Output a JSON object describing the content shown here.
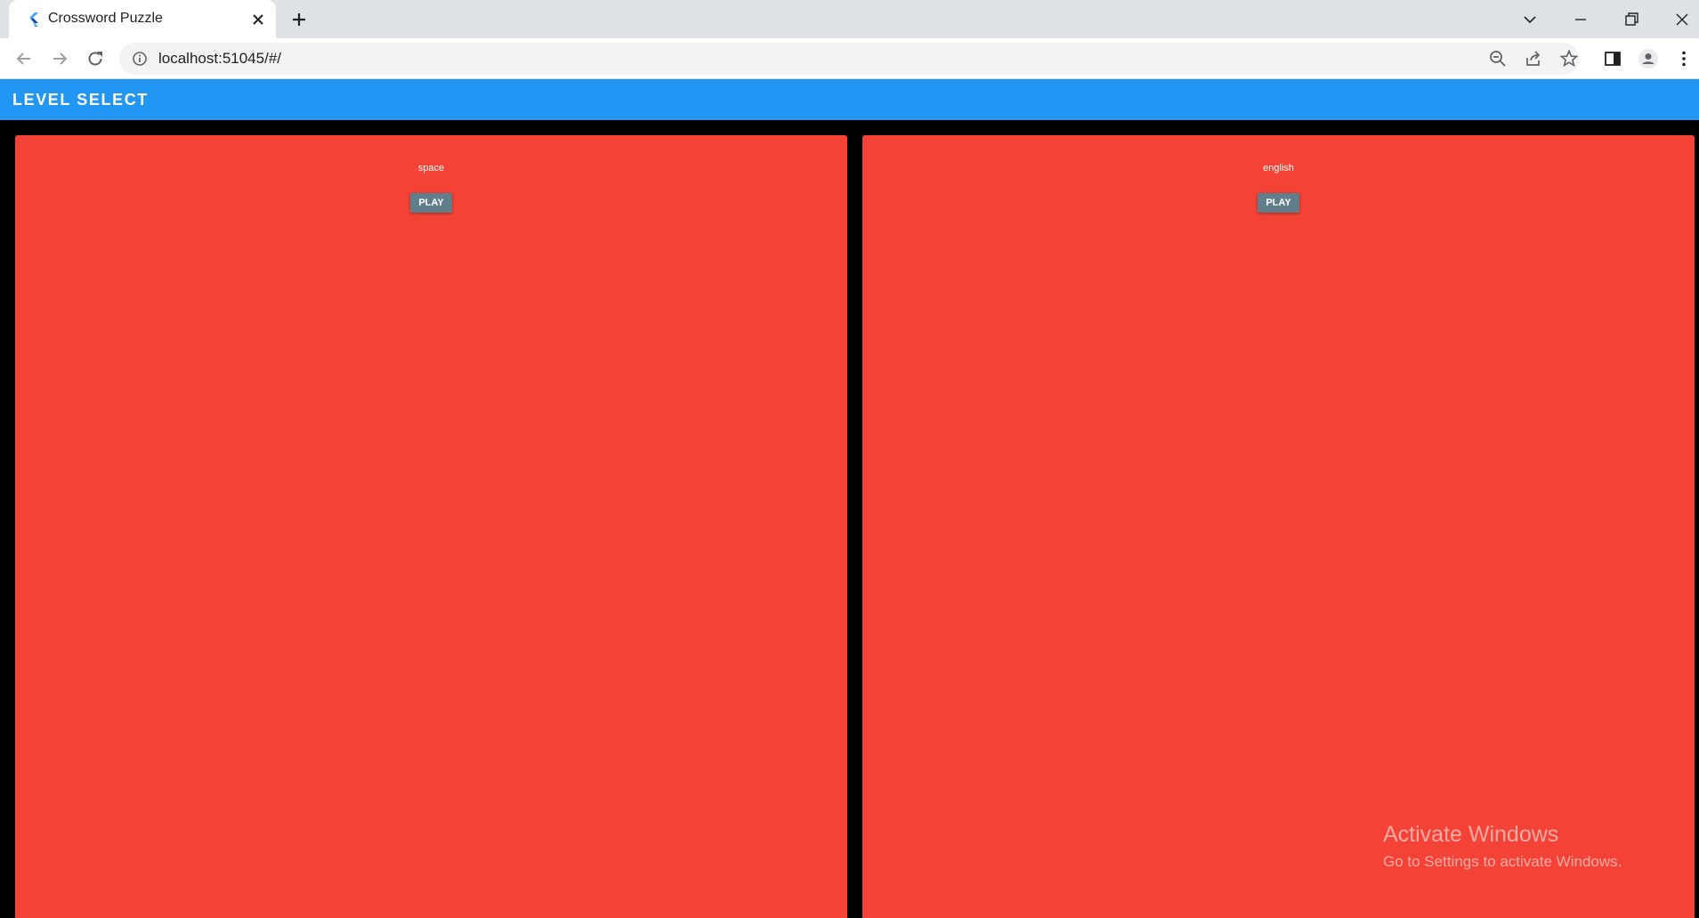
{
  "browser": {
    "tab": {
      "title": "Crossword Puzzle"
    },
    "address_bar": {
      "url": "localhost:51045/#/"
    }
  },
  "app": {
    "appbar": {
      "title": "LEVEL SELECT"
    },
    "levels": [
      {
        "name": "space",
        "button_label": "PLAY"
      },
      {
        "name": "english",
        "button_label": "PLAY"
      }
    ]
  },
  "watermark": {
    "title": "Activate Windows",
    "subtitle": "Go to Settings to activate Windows."
  },
  "colors": {
    "appbar": "#2196f3",
    "card": "#f44336",
    "button": "#607d8b",
    "background": "#000000"
  },
  "icons": [
    "flutter-icon",
    "close-icon",
    "plus-icon",
    "chevron-down-icon",
    "minimize-icon",
    "restore-icon",
    "back-icon",
    "forward-icon",
    "reload-icon",
    "info-icon",
    "zoom-out-icon",
    "share-icon",
    "star-icon",
    "side-panel-icon",
    "profile-icon",
    "more-vert-icon"
  ]
}
